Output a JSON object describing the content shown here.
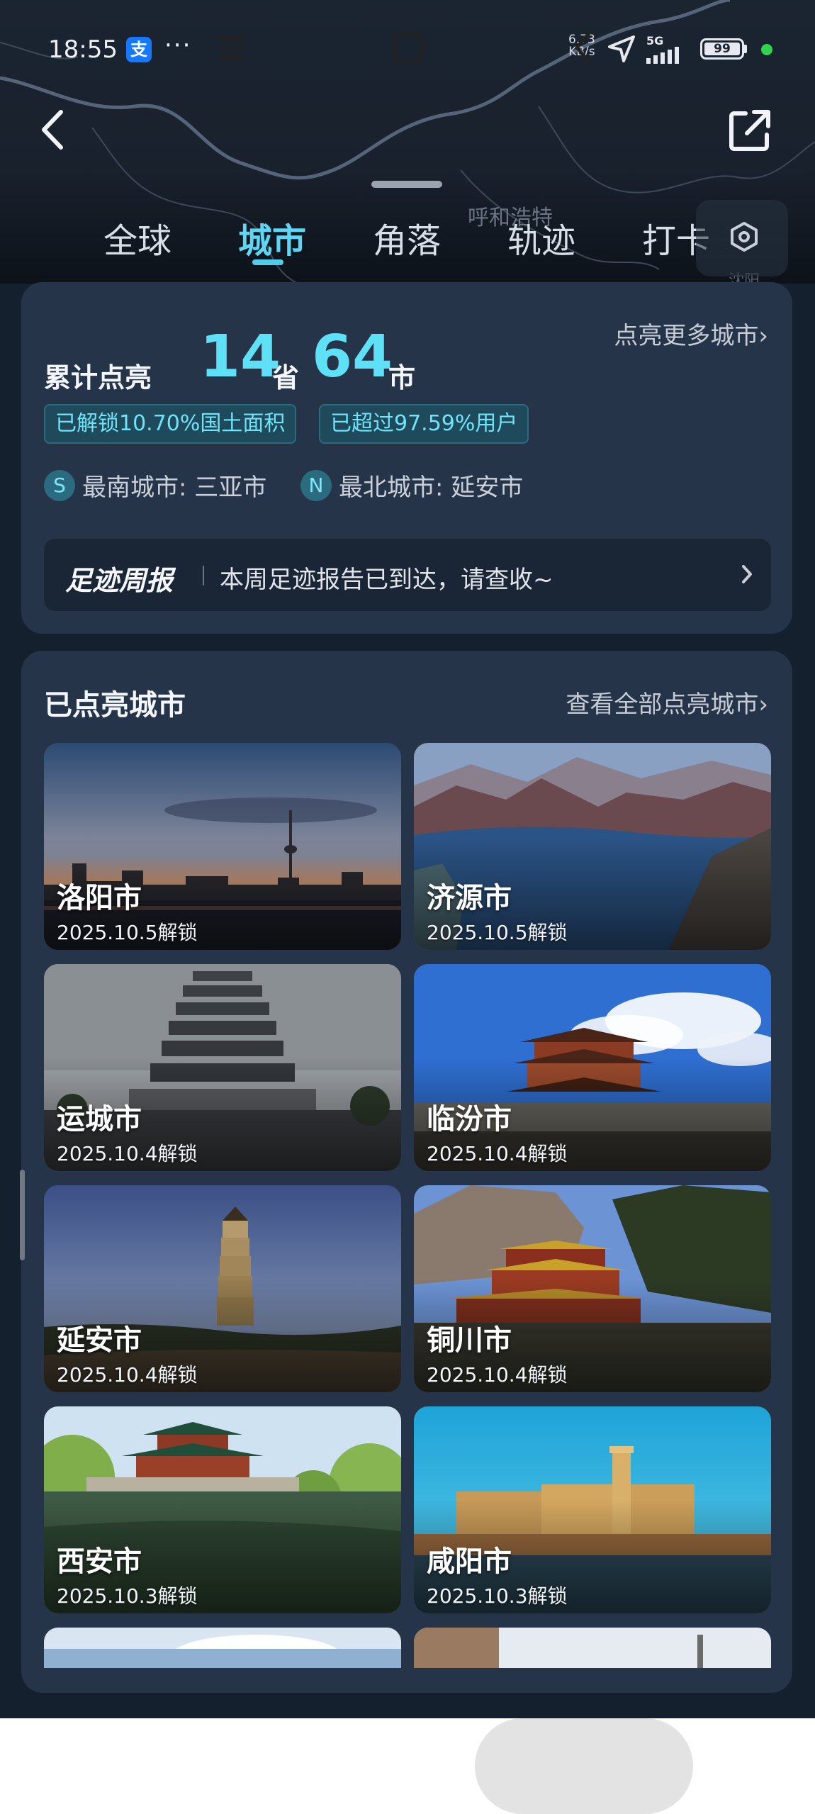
{
  "status_bar": {
    "time": "18:55",
    "app_icon": "支",
    "more": "···",
    "net_speed_value": "6.73",
    "net_speed_unit": "KB/s",
    "network": "5G",
    "battery": "99"
  },
  "map": {
    "city_label": "呼和浩特",
    "city_label_2": "沈阳"
  },
  "tabs": [
    {
      "label": "全球",
      "active": false
    },
    {
      "label": "城市",
      "active": true
    },
    {
      "label": "角落",
      "active": false
    },
    {
      "label": "轨迹",
      "active": false
    },
    {
      "label": "打卡",
      "active": false
    }
  ],
  "summary": {
    "prefix": "累计点亮",
    "provinces": "14",
    "province_unit": "省",
    "cities": "64",
    "city_unit": "市",
    "more_link": "点亮更多城市",
    "area_badge": "已解锁10.70%国土面积",
    "users_badge": "已超过97.59%用户",
    "south_badge": "S",
    "south": "最南城市: 三亚市",
    "north_badge": "N",
    "north": "最北城市: 延安市",
    "weekly_title": "足迹周报",
    "weekly_text": "本周足迹报告已到达，请查收~"
  },
  "lit_cities": {
    "title": "已点亮城市",
    "view_all": "查看全部点亮城市",
    "items": [
      {
        "name": "洛阳市",
        "date": "2025.10.5解锁"
      },
      {
        "name": "济源市",
        "date": "2025.10.5解锁"
      },
      {
        "name": "运城市",
        "date": "2025.10.4解锁"
      },
      {
        "name": "临汾市",
        "date": "2025.10.4解锁"
      },
      {
        "name": "延安市",
        "date": "2025.10.4解锁"
      },
      {
        "name": "铜川市",
        "date": "2025.10.4解锁"
      },
      {
        "name": "西安市",
        "date": "2025.10.3解锁"
      },
      {
        "name": "咸阳市",
        "date": "2025.10.3解锁"
      },
      {
        "name": "",
        "date": ""
      },
      {
        "name": "",
        "date": ""
      }
    ]
  },
  "icons": {
    "back": "chevron-left-icon",
    "share": "share-external-icon",
    "settings": "hexagon-settings-icon",
    "nav_menu": "menu-icon",
    "nav_home": "home-square-icon",
    "nav_back": "back-chevron-icon"
  },
  "colors": {
    "accent": "#5fd6f3",
    "card_bg": "#263449",
    "page_bg": "#15202f"
  }
}
